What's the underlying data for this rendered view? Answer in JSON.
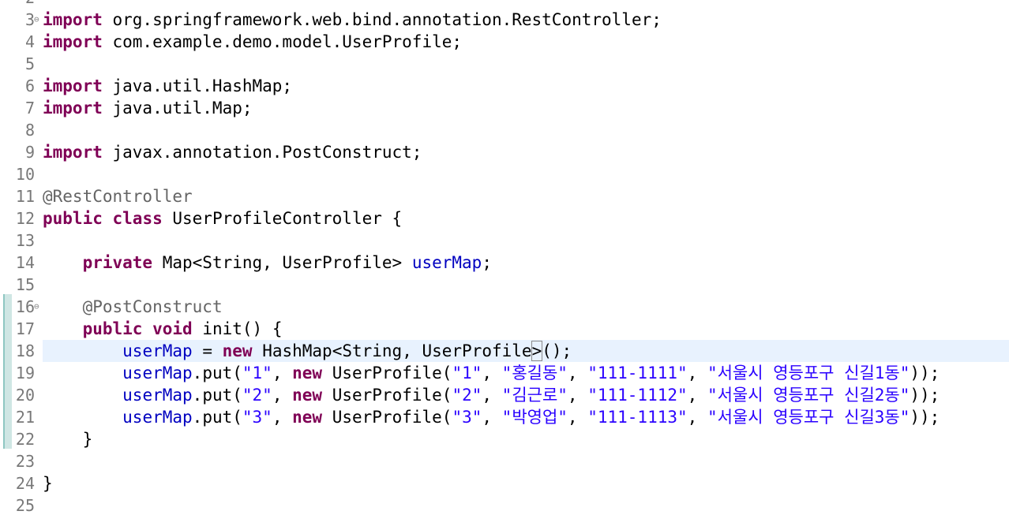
{
  "editor": {
    "language": "Java",
    "current_line": "18",
    "top_partial_line": "2",
    "lines": [
      {
        "n": "3",
        "fold": true,
        "tokens": [
          {
            "t": "import",
            "c": "kw"
          },
          {
            "t": " org.springframework.web.bind.annotation.RestController;",
            "c": "plain"
          }
        ]
      },
      {
        "n": "4",
        "tokens": [
          {
            "t": "import",
            "c": "kw"
          },
          {
            "t": " com.example.demo.model.UserProfile;",
            "c": "plain"
          }
        ]
      },
      {
        "n": "5",
        "tokens": []
      },
      {
        "n": "6",
        "tokens": [
          {
            "t": "import",
            "c": "kw"
          },
          {
            "t": " java.util.HashMap;",
            "c": "plain"
          }
        ]
      },
      {
        "n": "7",
        "tokens": [
          {
            "t": "import",
            "c": "kw"
          },
          {
            "t": " java.util.Map;",
            "c": "plain"
          }
        ]
      },
      {
        "n": "8",
        "tokens": []
      },
      {
        "n": "9",
        "tokens": [
          {
            "t": "import",
            "c": "kw"
          },
          {
            "t": " javax.annotation.PostConstruct;",
            "c": "plain"
          }
        ]
      },
      {
        "n": "10",
        "tokens": []
      },
      {
        "n": "11",
        "tokens": [
          {
            "t": "@RestController",
            "c": "ann"
          }
        ]
      },
      {
        "n": "12",
        "tokens": [
          {
            "t": "public",
            "c": "kw"
          },
          {
            "t": " ",
            "c": "plain"
          },
          {
            "t": "class",
            "c": "kw"
          },
          {
            "t": " UserProfileController {",
            "c": "plain"
          }
        ]
      },
      {
        "n": "13",
        "tokens": []
      },
      {
        "n": "14",
        "tokens": [
          {
            "t": "    ",
            "c": "plain"
          },
          {
            "t": "private",
            "c": "kw"
          },
          {
            "t": " Map<String, UserProfile> ",
            "c": "plain"
          },
          {
            "t": "userMap",
            "c": "fld"
          },
          {
            "t": ";",
            "c": "plain"
          }
        ]
      },
      {
        "n": "15",
        "tokens": []
      },
      {
        "n": "16",
        "fold": true,
        "tokens": [
          {
            "t": "    ",
            "c": "plain"
          },
          {
            "t": "@PostConstruct",
            "c": "ann"
          }
        ]
      },
      {
        "n": "17",
        "tokens": [
          {
            "t": "    ",
            "c": "plain"
          },
          {
            "t": "public",
            "c": "kw"
          },
          {
            "t": " ",
            "c": "plain"
          },
          {
            "t": "void",
            "c": "kw"
          },
          {
            "t": " init() {",
            "c": "plain"
          }
        ]
      },
      {
        "n": "18",
        "tokens": [
          {
            "t": "        ",
            "c": "plain"
          },
          {
            "t": "userMap",
            "c": "fld"
          },
          {
            "t": " = ",
            "c": "plain"
          },
          {
            "t": "new",
            "c": "kw"
          },
          {
            "t": " HashMap<String, UserProfile",
            "c": "plain"
          },
          {
            "t": ">",
            "c": "bracket"
          },
          {
            "t": "();",
            "c": "plain"
          }
        ]
      },
      {
        "n": "19",
        "tokens": [
          {
            "t": "        ",
            "c": "plain"
          },
          {
            "t": "userMap",
            "c": "fld"
          },
          {
            "t": ".put(",
            "c": "plain"
          },
          {
            "t": "\"1\"",
            "c": "str"
          },
          {
            "t": ", ",
            "c": "plain"
          },
          {
            "t": "new",
            "c": "kw"
          },
          {
            "t": " UserProfile(",
            "c": "plain"
          },
          {
            "t": "\"1\"",
            "c": "str"
          },
          {
            "t": ", ",
            "c": "plain"
          },
          {
            "t": "\"홍길동\"",
            "c": "str"
          },
          {
            "t": ", ",
            "c": "plain"
          },
          {
            "t": "\"111-1111\"",
            "c": "str"
          },
          {
            "t": ", ",
            "c": "plain"
          },
          {
            "t": "\"서울시 영등포구 신길1동\"",
            "c": "str"
          },
          {
            "t": "));",
            "c": "plain"
          }
        ]
      },
      {
        "n": "20",
        "tokens": [
          {
            "t": "        ",
            "c": "plain"
          },
          {
            "t": "userMap",
            "c": "fld"
          },
          {
            "t": ".put(",
            "c": "plain"
          },
          {
            "t": "\"2\"",
            "c": "str"
          },
          {
            "t": ", ",
            "c": "plain"
          },
          {
            "t": "new",
            "c": "kw"
          },
          {
            "t": " UserProfile(",
            "c": "plain"
          },
          {
            "t": "\"2\"",
            "c": "str"
          },
          {
            "t": ", ",
            "c": "plain"
          },
          {
            "t": "\"김근로\"",
            "c": "str"
          },
          {
            "t": ", ",
            "c": "plain"
          },
          {
            "t": "\"111-1112\"",
            "c": "str"
          },
          {
            "t": ", ",
            "c": "plain"
          },
          {
            "t": "\"서울시 영등포구 신길2동\"",
            "c": "str"
          },
          {
            "t": "));",
            "c": "plain"
          }
        ]
      },
      {
        "n": "21",
        "tokens": [
          {
            "t": "        ",
            "c": "plain"
          },
          {
            "t": "userMap",
            "c": "fld"
          },
          {
            "t": ".put(",
            "c": "plain"
          },
          {
            "t": "\"3\"",
            "c": "str"
          },
          {
            "t": ", ",
            "c": "plain"
          },
          {
            "t": "new",
            "c": "kw"
          },
          {
            "t": " UserProfile(",
            "c": "plain"
          },
          {
            "t": "\"3\"",
            "c": "str"
          },
          {
            "t": ", ",
            "c": "plain"
          },
          {
            "t": "\"박영업\"",
            "c": "str"
          },
          {
            "t": ", ",
            "c": "plain"
          },
          {
            "t": "\"111-1113\"",
            "c": "str"
          },
          {
            "t": ", ",
            "c": "plain"
          },
          {
            "t": "\"서울시 영등포구 신길3동\"",
            "c": "str"
          },
          {
            "t": "));",
            "c": "plain"
          }
        ]
      },
      {
        "n": "22",
        "tokens": [
          {
            "t": "    }",
            "c": "plain"
          }
        ]
      },
      {
        "n": "23",
        "tokens": []
      },
      {
        "n": "24",
        "tokens": [
          {
            "t": "}",
            "c": "plain"
          }
        ]
      },
      {
        "n": "25",
        "tokens": []
      }
    ],
    "changed_lines": [
      "16",
      "22"
    ],
    "colors": {
      "keyword": "#7f0055",
      "annotation": "#646464",
      "field": "#0000c0",
      "string": "#2a00ff",
      "line_number": "#787878",
      "current_line_bg": "#e8f2fe",
      "change_bar": "#cfe6e4"
    },
    "icons": {
      "fold": "fold-collapse-icon"
    }
  }
}
